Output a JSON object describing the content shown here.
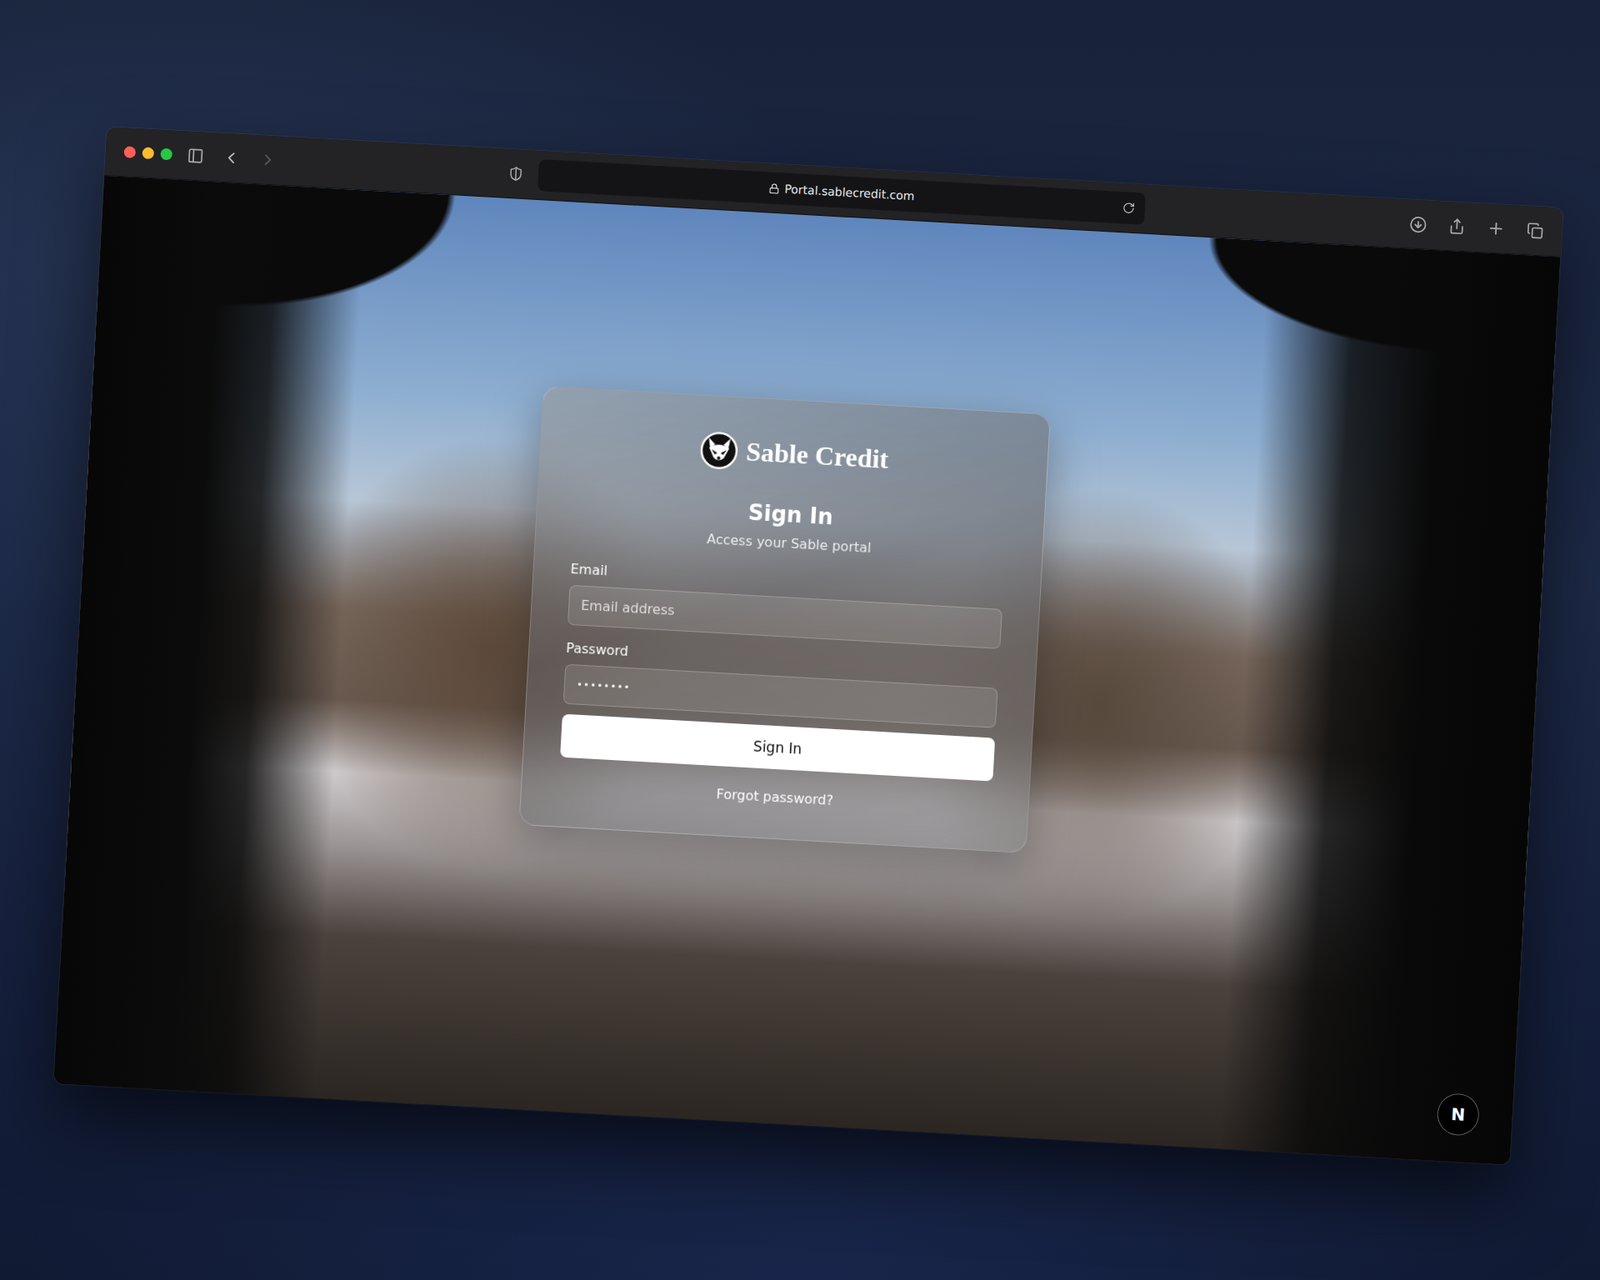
{
  "browser": {
    "address": "Portal.sablecredit.com",
    "back_enabled": true,
    "forward_enabled": false
  },
  "login": {
    "brand": "Sable Credit",
    "title": "Sign In",
    "subtitle": "Access your Sable portal",
    "fields": [
      {
        "label": "Email",
        "placeholder": "Email address",
        "value": "",
        "kind": "email"
      },
      {
        "label": "Password",
        "placeholder": "",
        "value": "••••••••",
        "kind": "password"
      }
    ],
    "submit": "Sign In",
    "link": "Forgot password?"
  },
  "dev_badge": "N"
}
